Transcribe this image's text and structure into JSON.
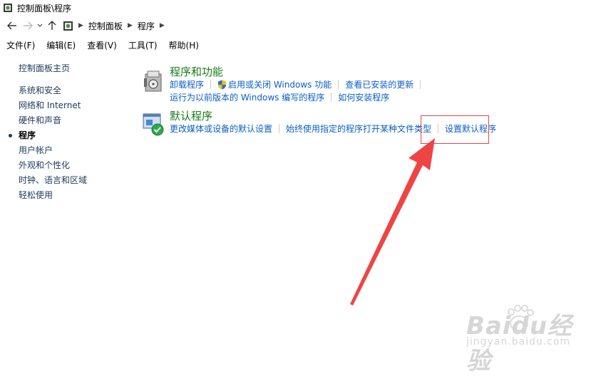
{
  "window": {
    "title": "控制面板\\程序"
  },
  "breadcrumbs": [
    "控制面板",
    "程序"
  ],
  "menu": [
    "文件(F)",
    "编辑(E)",
    "查看(V)",
    "工具(T)",
    "帮助(H)"
  ],
  "sidebar": {
    "home": "控制面板主页",
    "items": [
      "系统和安全",
      "网络和 Internet",
      "硬件和声音",
      "程序",
      "用户帐户",
      "外观和个性化",
      "时钟、语言和区域",
      "轻松使用"
    ],
    "active": "程序"
  },
  "sections": {
    "programs": {
      "title": "程序和功能",
      "row1": [
        "卸载程序",
        "启用或关闭 Windows 功能",
        "查看已安装的更新"
      ],
      "row2": [
        "运行为以前版本的 Windows 编写的程序",
        "如何安装程序"
      ]
    },
    "defaults": {
      "title": "默认程序",
      "row1": [
        "更改媒体或设备的默认设置",
        "始终使用指定的程序打开某种文件类型",
        "设置默认程序"
      ]
    }
  },
  "watermark": {
    "brand": "Baidu经验",
    "url": "jingyan.baidu.com"
  },
  "colors": {
    "link": "#0b5ec8",
    "heading": "#1a7a1a",
    "annotation": "#e3454a"
  }
}
